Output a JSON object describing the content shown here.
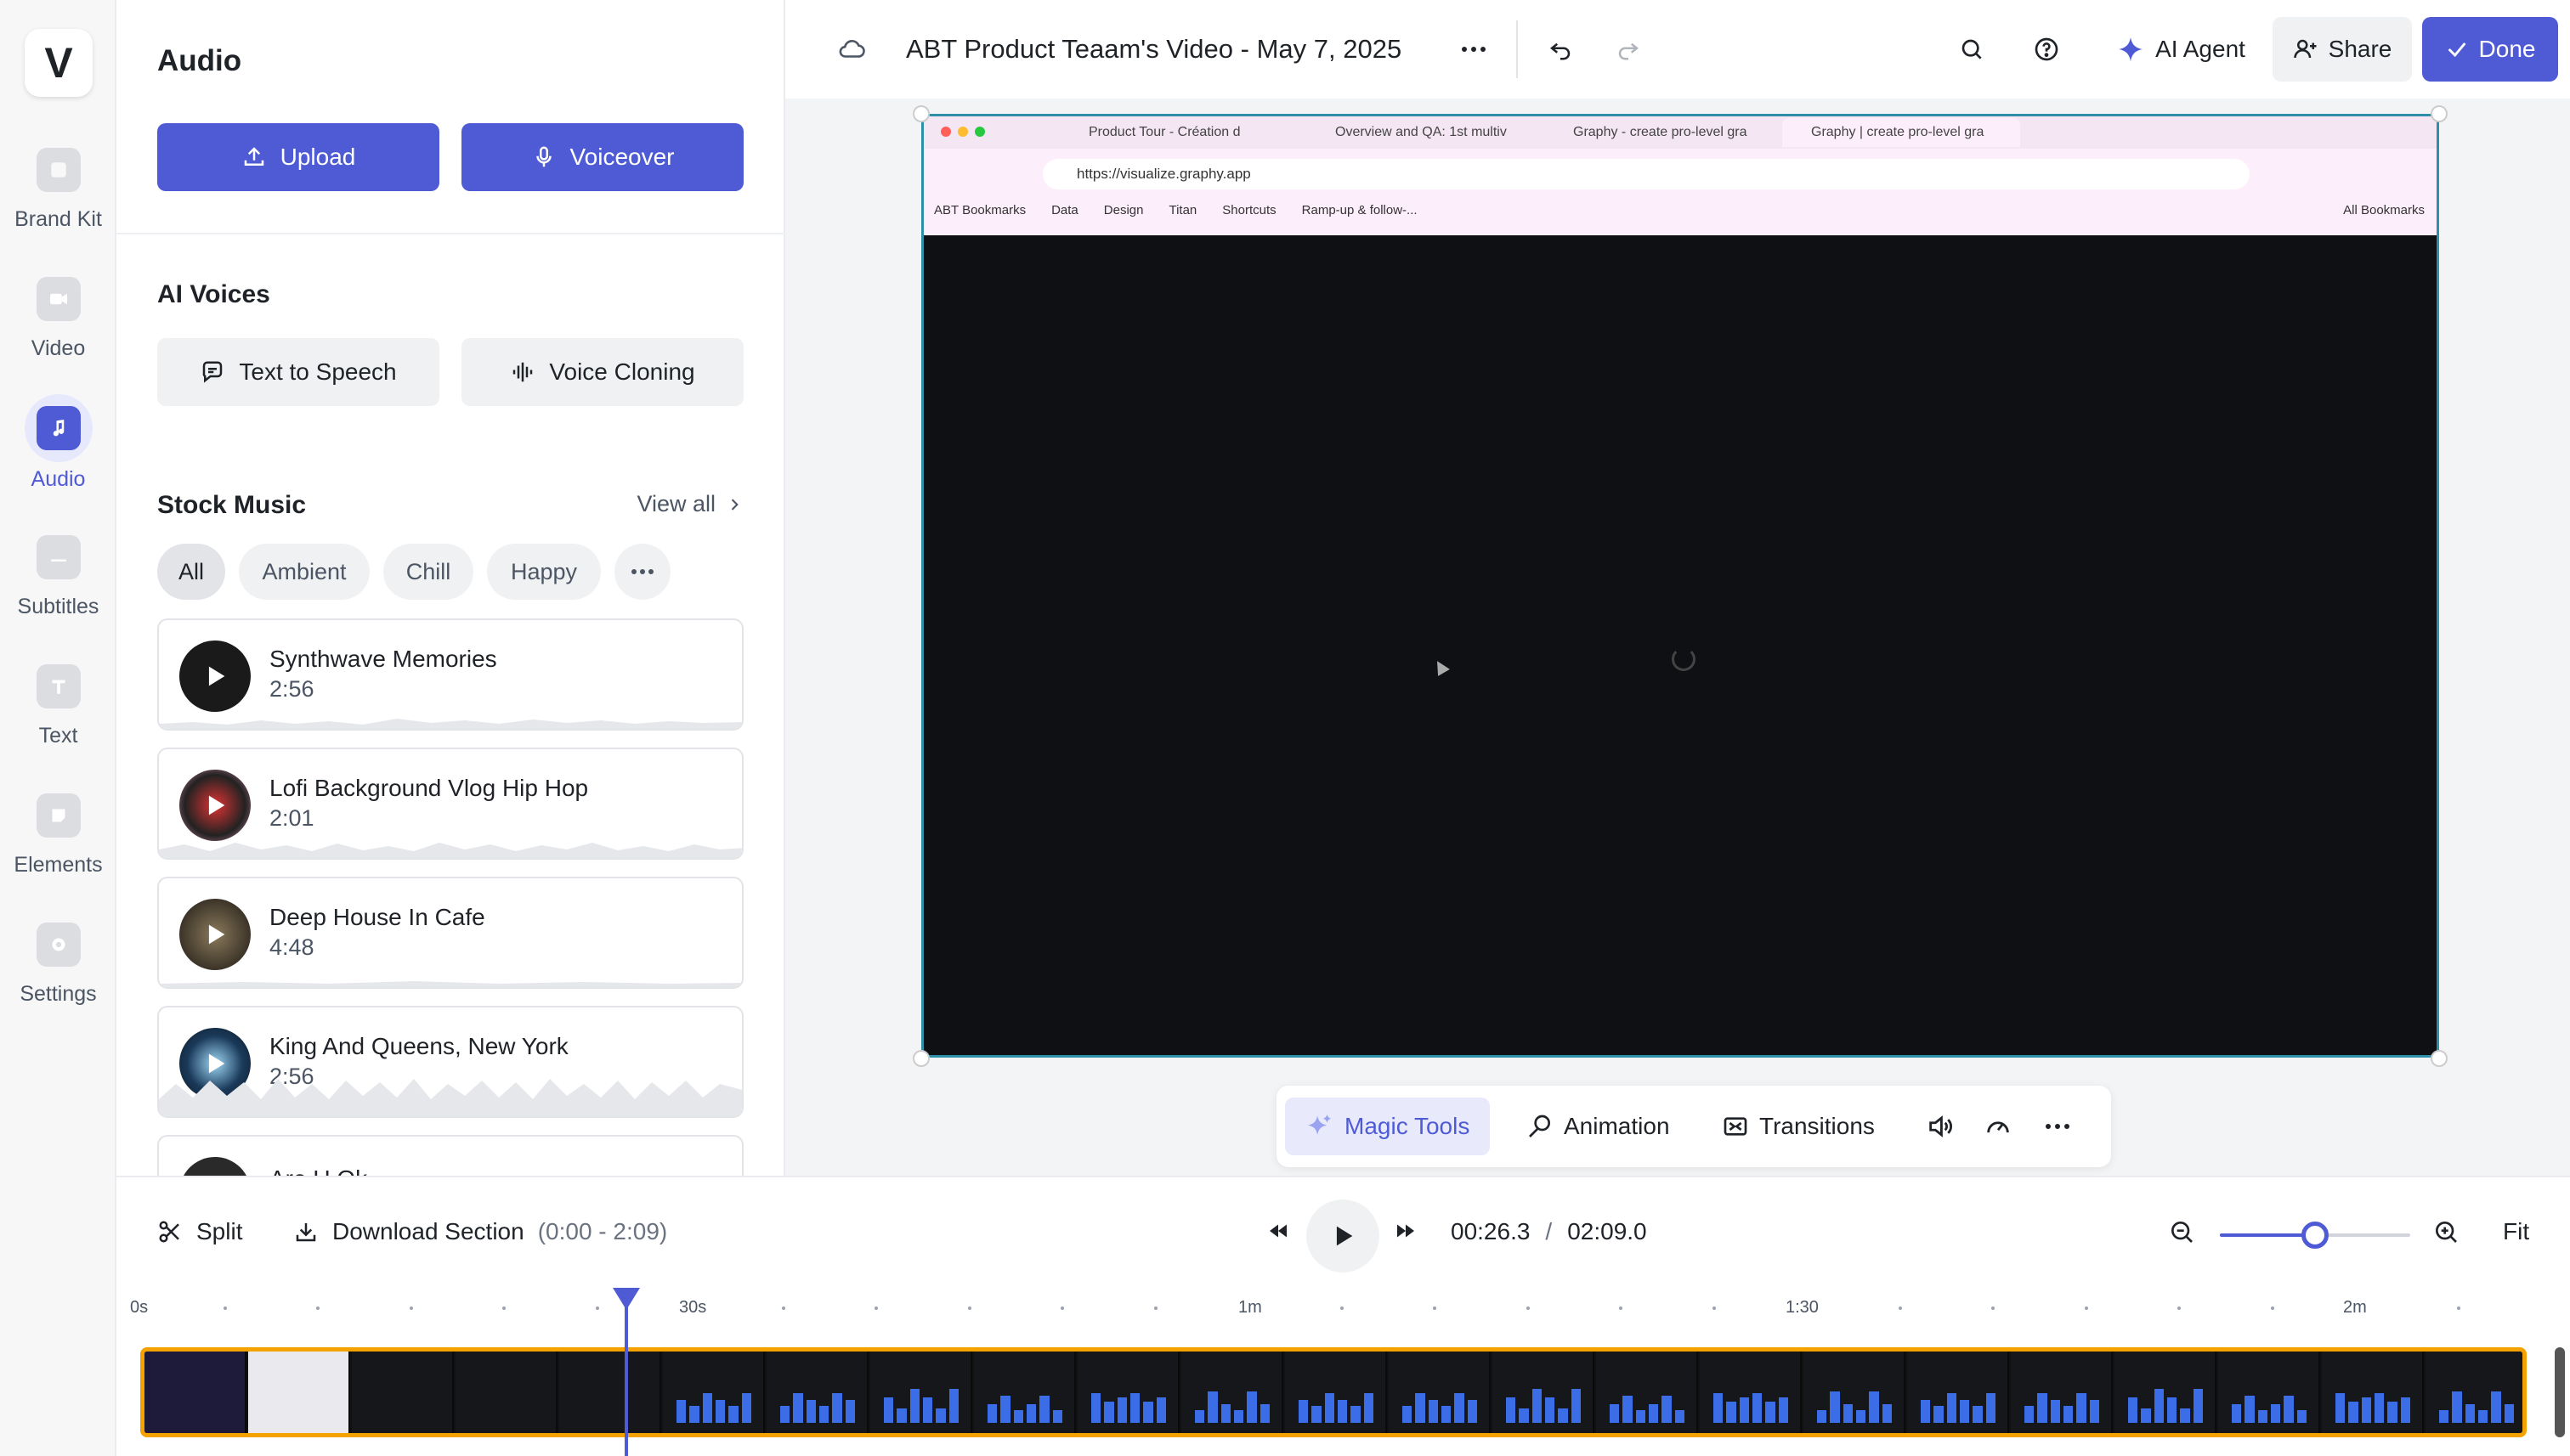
{
  "rail": {
    "logo": "V",
    "items": [
      {
        "label": "Brand Kit",
        "icon": "brand-kit-icon"
      },
      {
        "label": "Video",
        "icon": "video-icon"
      },
      {
        "label": "Audio",
        "icon": "music-note-icon"
      },
      {
        "label": "Subtitles",
        "icon": "subtitles-icon"
      },
      {
        "label": "Text",
        "icon": "text-icon"
      },
      {
        "label": "Elements",
        "icon": "elements-icon"
      },
      {
        "label": "Settings",
        "icon": "settings-icon"
      }
    ],
    "active_index": 2
  },
  "panel": {
    "title": "Audio",
    "upload_label": "Upload",
    "voiceover_label": "Voiceover",
    "ai_voices_title": "AI Voices",
    "tts_label": "Text to Speech",
    "cloning_label": "Voice Cloning",
    "stock_title": "Stock Music",
    "view_all": "View all",
    "filters": [
      "All",
      "Ambient",
      "Chill",
      "Happy"
    ],
    "tracks": [
      {
        "name": "Synthwave Memories",
        "duration": "2:56"
      },
      {
        "name": "Lofi Background Vlog Hip Hop",
        "duration": "2:01"
      },
      {
        "name": "Deep House In Cafe",
        "duration": "4:48"
      },
      {
        "name": "King And Queens, New York",
        "duration": "2:56"
      },
      {
        "name": "Are U Ok",
        "duration": ""
      }
    ]
  },
  "header": {
    "title": "ABT Product Teaam's Video - May 7, 2025",
    "ai_agent": "AI Agent",
    "share": "Share",
    "done": "Done"
  },
  "browser": {
    "tabs": [
      "Product Tour - Création d",
      "Overview and QA: 1st multiv",
      "Graphy - create pro-level gra",
      "Graphy | create pro-level gra"
    ],
    "url": "https://visualize.graphy.app",
    "bookmarks": [
      "ABT Bookmarks",
      "Data",
      "Design",
      "Titan",
      "Shortcuts",
      "Ramp-up & follow-..."
    ],
    "all_bookmarks": "All Bookmarks"
  },
  "toolbar": {
    "magic_tools": "Magic Tools",
    "animation": "Animation",
    "transitions": "Transitions"
  },
  "timeline": {
    "split": "Split",
    "download_section": "Download Section",
    "section_range": "(0:00 - 2:09)",
    "current_time": "00:26.3",
    "separator": "/",
    "total_time": "02:09.0",
    "fit": "Fit",
    "ruler_labels": [
      "0s",
      "30s",
      "1m",
      "1:30",
      "2m"
    ],
    "zoom_level": 0.5
  }
}
